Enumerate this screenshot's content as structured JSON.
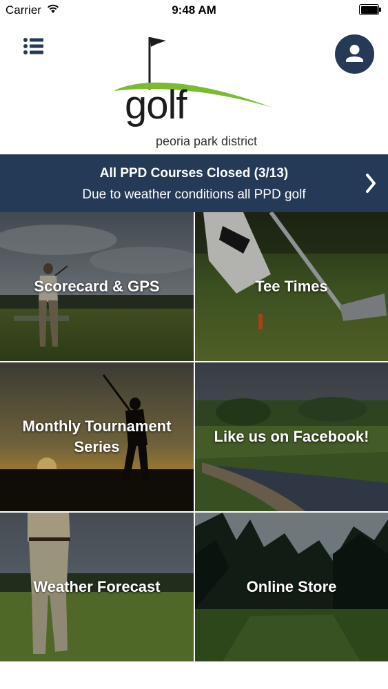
{
  "status_bar": {
    "carrier": "Carrier",
    "time": "9:48 AM",
    "icons": [
      "wifi-icon",
      "battery-icon"
    ]
  },
  "header": {
    "menu_icon": "list-menu-icon",
    "profile_icon": "user-icon",
    "logo": {
      "word": "golf",
      "subtitle": "peoria park district"
    }
  },
  "banner": {
    "title": "All PPD Courses Closed (3/13)",
    "text": "Due to weather conditions all PPD golf",
    "arrow_icon": "chevron-right-icon"
  },
  "tiles": [
    {
      "label": "Scorecard & GPS"
    },
    {
      "label": "Tee Times"
    },
    {
      "label": "Monthly Tournament Series"
    },
    {
      "label": "Like us on Facebook!"
    },
    {
      "label": "Weather Forecast"
    },
    {
      "label": "Online Store"
    }
  ],
  "colors": {
    "brand_navy": "#243a57",
    "logo_green": "#7cbb2f"
  }
}
